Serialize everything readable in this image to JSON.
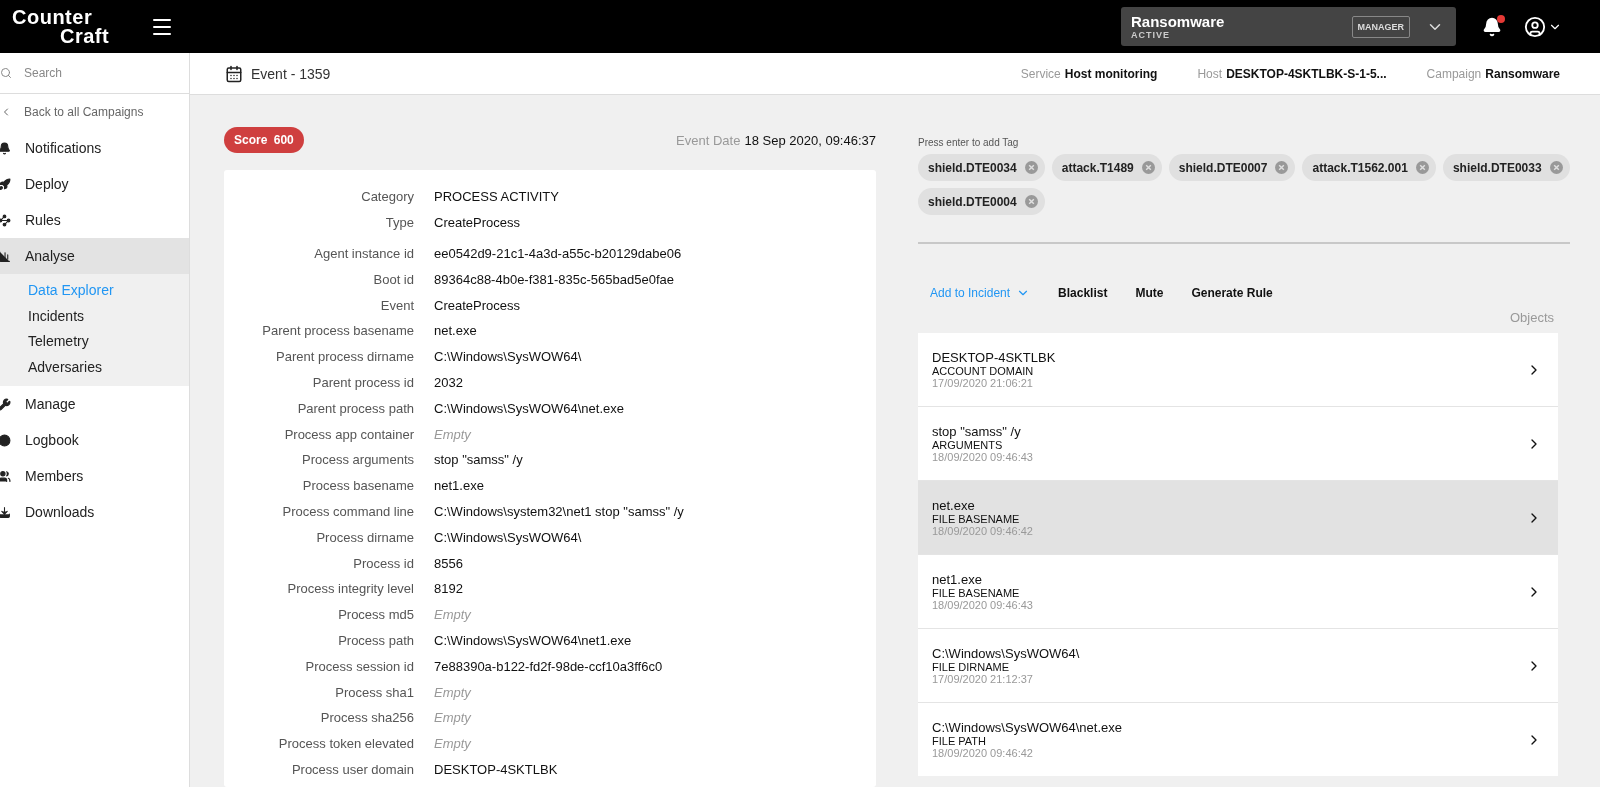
{
  "header": {
    "logo": {
      "line_1": "Counter",
      "line_2": "Craft"
    },
    "campaign_selector": {
      "name": "Ransomware",
      "status": "ACTIVE",
      "role": "MANAGER"
    },
    "notifications": {
      "unread": true
    }
  },
  "sidebar": {
    "search": {
      "placeholder": "Search"
    },
    "back_link": "Back to all Campaigns",
    "items": [
      {
        "label": "Notifications",
        "selected": false,
        "expanded": false
      },
      {
        "label": "Deploy",
        "selected": false,
        "expanded": false
      },
      {
        "label": "Rules",
        "selected": false,
        "expanded": false
      },
      {
        "label": "Analyse",
        "selected": true,
        "expanded": true,
        "children": [
          {
            "label": "Data Explorer",
            "selected": true
          },
          {
            "label": "Incidents",
            "selected": false
          },
          {
            "label": "Telemetry",
            "selected": false
          },
          {
            "label": "Adversaries",
            "selected": false
          }
        ]
      },
      {
        "label": "Manage",
        "selected": false,
        "expanded": false
      },
      {
        "label": "Logbook",
        "selected": false,
        "expanded": false
      },
      {
        "label": "Members",
        "selected": false,
        "expanded": false
      },
      {
        "label": "Downloads",
        "selected": false,
        "expanded": false
      }
    ]
  },
  "subheader": {
    "title": "Event - 1359",
    "meta": [
      {
        "label": "Service",
        "value": "Host monitoring"
      },
      {
        "label": "Host",
        "value": "DESKTOP-4SKTLBK-S-1-5..."
      },
      {
        "label": "Campaign",
        "value": "Ransomware"
      }
    ]
  },
  "score": {
    "label": "Score",
    "value": "600"
  },
  "event_date": {
    "label": "Event Date",
    "value": "18 Sep 2020, 09:46:37"
  },
  "detail_sections": [
    [
      {
        "label": "Category",
        "value": "PROCESS ACTIVITY",
        "empty": false
      },
      {
        "label": "Type",
        "value": "CreateProcess",
        "empty": false
      }
    ],
    [
      {
        "label": "Agent instance id",
        "value": "ee0542d9-21c1-4a3d-a55c-b20129dabe06",
        "empty": false
      },
      {
        "label": "Boot id",
        "value": "89364c88-4b0e-f381-835c-565bad5e0fae",
        "empty": false
      },
      {
        "label": "Event",
        "value": "CreateProcess",
        "empty": false
      },
      {
        "label": "Parent process basename",
        "value": "net.exe",
        "empty": false
      },
      {
        "label": "Parent process dirname",
        "value": "C:\\Windows\\SysWOW64\\",
        "empty": false
      },
      {
        "label": "Parent process id",
        "value": "2032",
        "empty": false
      },
      {
        "label": "Parent process path",
        "value": "C:\\Windows\\SysWOW64\\net.exe",
        "empty": false
      },
      {
        "label": "Process app container",
        "value": "Empty",
        "empty": true
      },
      {
        "label": "Process arguments",
        "value": "stop \"samss\" /y",
        "empty": false
      },
      {
        "label": "Process basename",
        "value": "net1.exe",
        "empty": false
      },
      {
        "label": "Process command line",
        "value": "C:\\Windows\\system32\\net1 stop \"samss\" /y",
        "empty": false
      },
      {
        "label": "Process dirname",
        "value": "C:\\Windows\\SysWOW64\\",
        "empty": false
      },
      {
        "label": "Process id",
        "value": "8556",
        "empty": false
      },
      {
        "label": "Process integrity level",
        "value": "8192",
        "empty": false
      },
      {
        "label": "Process md5",
        "value": "Empty",
        "empty": true
      },
      {
        "label": "Process path",
        "value": "C:\\Windows\\SysWOW64\\net1.exe",
        "empty": false
      },
      {
        "label": "Process session id",
        "value": "7e88390a-b122-fd2f-98de-ccf10a3ff6c0",
        "empty": false
      },
      {
        "label": "Process sha1",
        "value": "Empty",
        "empty": true
      },
      {
        "label": "Process sha256",
        "value": "Empty",
        "empty": true
      },
      {
        "label": "Process token elevated",
        "value": "Empty",
        "empty": true
      },
      {
        "label": "Process user domain",
        "value": "DESKTOP-4SKTLBK",
        "empty": false
      }
    ]
  ],
  "tags": {
    "hint": "Press enter to add Tag",
    "items": [
      "shield.DTE0034",
      "attack.T1489",
      "shield.DTE0007",
      "attack.T1562.001",
      "shield.DTE0033",
      "shield.DTE0004"
    ]
  },
  "actions": [
    {
      "label": "Add to Incident",
      "kind": "dropdown"
    },
    {
      "label": "Blacklist",
      "kind": "plain"
    },
    {
      "label": "Mute",
      "kind": "plain"
    },
    {
      "label": "Generate Rule",
      "kind": "plain"
    }
  ],
  "objects": {
    "title": "Objects",
    "items": [
      {
        "value": "DESKTOP-4SKTLBK",
        "type": "ACCOUNT DOMAIN",
        "time": "17/09/2020 21:06:21",
        "selected": false
      },
      {
        "value": "stop \"samss\" /y",
        "type": "ARGUMENTS",
        "time": "18/09/2020 09:46:43",
        "selected": false
      },
      {
        "value": "net.exe",
        "type": "FILE BASENAME",
        "time": "18/09/2020 09:46:42",
        "selected": true
      },
      {
        "value": "net1.exe",
        "type": "FILE BASENAME",
        "time": "18/09/2020 09:46:43",
        "selected": false
      },
      {
        "value": "C:\\Windows\\SysWOW64\\",
        "type": "FILE DIRNAME",
        "time": "17/09/2020 21:12:37",
        "selected": false
      },
      {
        "value": "C:\\Windows\\SysWOW64\\net.exe",
        "type": "FILE PATH",
        "time": "18/09/2020 09:46:42",
        "selected": false
      }
    ]
  }
}
